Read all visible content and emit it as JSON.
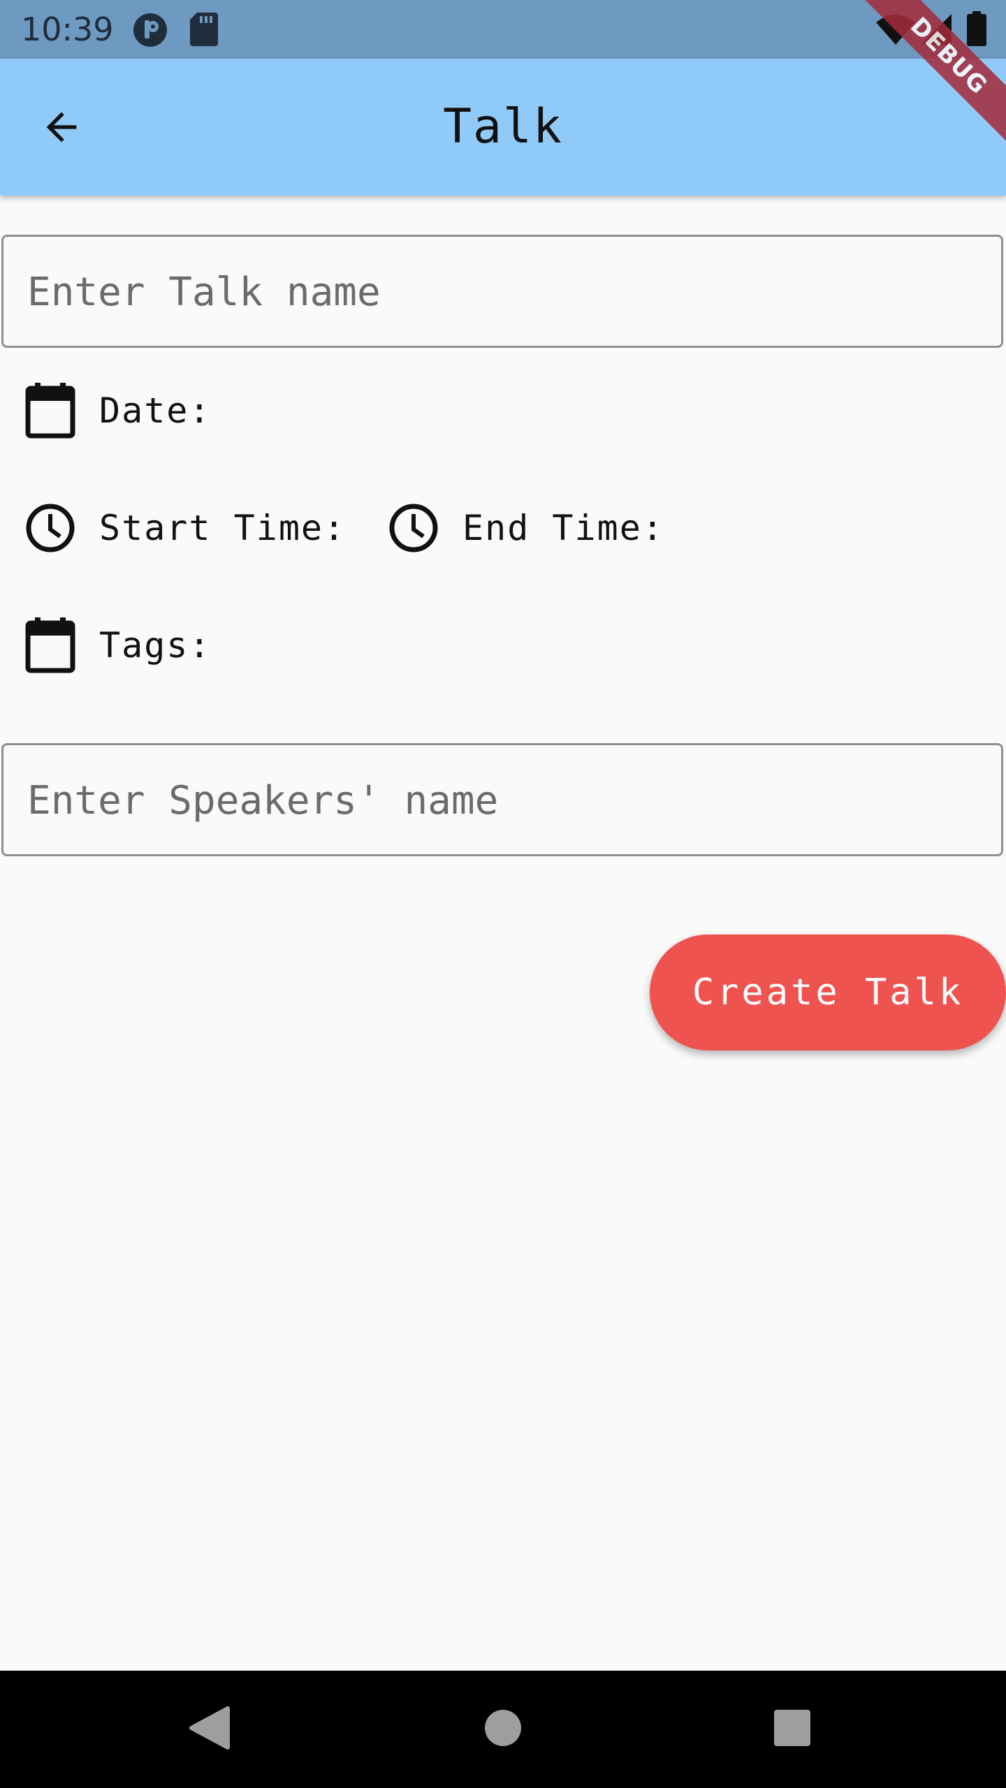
{
  "status_bar": {
    "time": "10:39",
    "icons": [
      "podcast-icon",
      "sd-card-icon",
      "wifi-icon",
      "signal-icon",
      "battery-icon"
    ]
  },
  "app_bar": {
    "title": "Talk",
    "back_icon": "arrow-back-icon"
  },
  "debug_banner": {
    "label": "DEBUG"
  },
  "form": {
    "talk_name": {
      "placeholder": "Enter Talk name",
      "value": ""
    },
    "date_label": "Date:",
    "start_time_label": "Start Time:",
    "end_time_label": "End Time:",
    "tags_label": "Tags:",
    "speakers_name": {
      "placeholder": "Enter Speakers' name",
      "value": ""
    }
  },
  "actions": {
    "create_label": "Create Talk"
  },
  "nav_bar": {
    "icons": [
      "nav-back-icon",
      "nav-home-icon",
      "nav-recents-icon"
    ]
  },
  "colors": {
    "app_bar": "#90caf9",
    "status_bar": "#6e99c0",
    "accent_button": "#ef5350",
    "background": "#fafafa"
  }
}
